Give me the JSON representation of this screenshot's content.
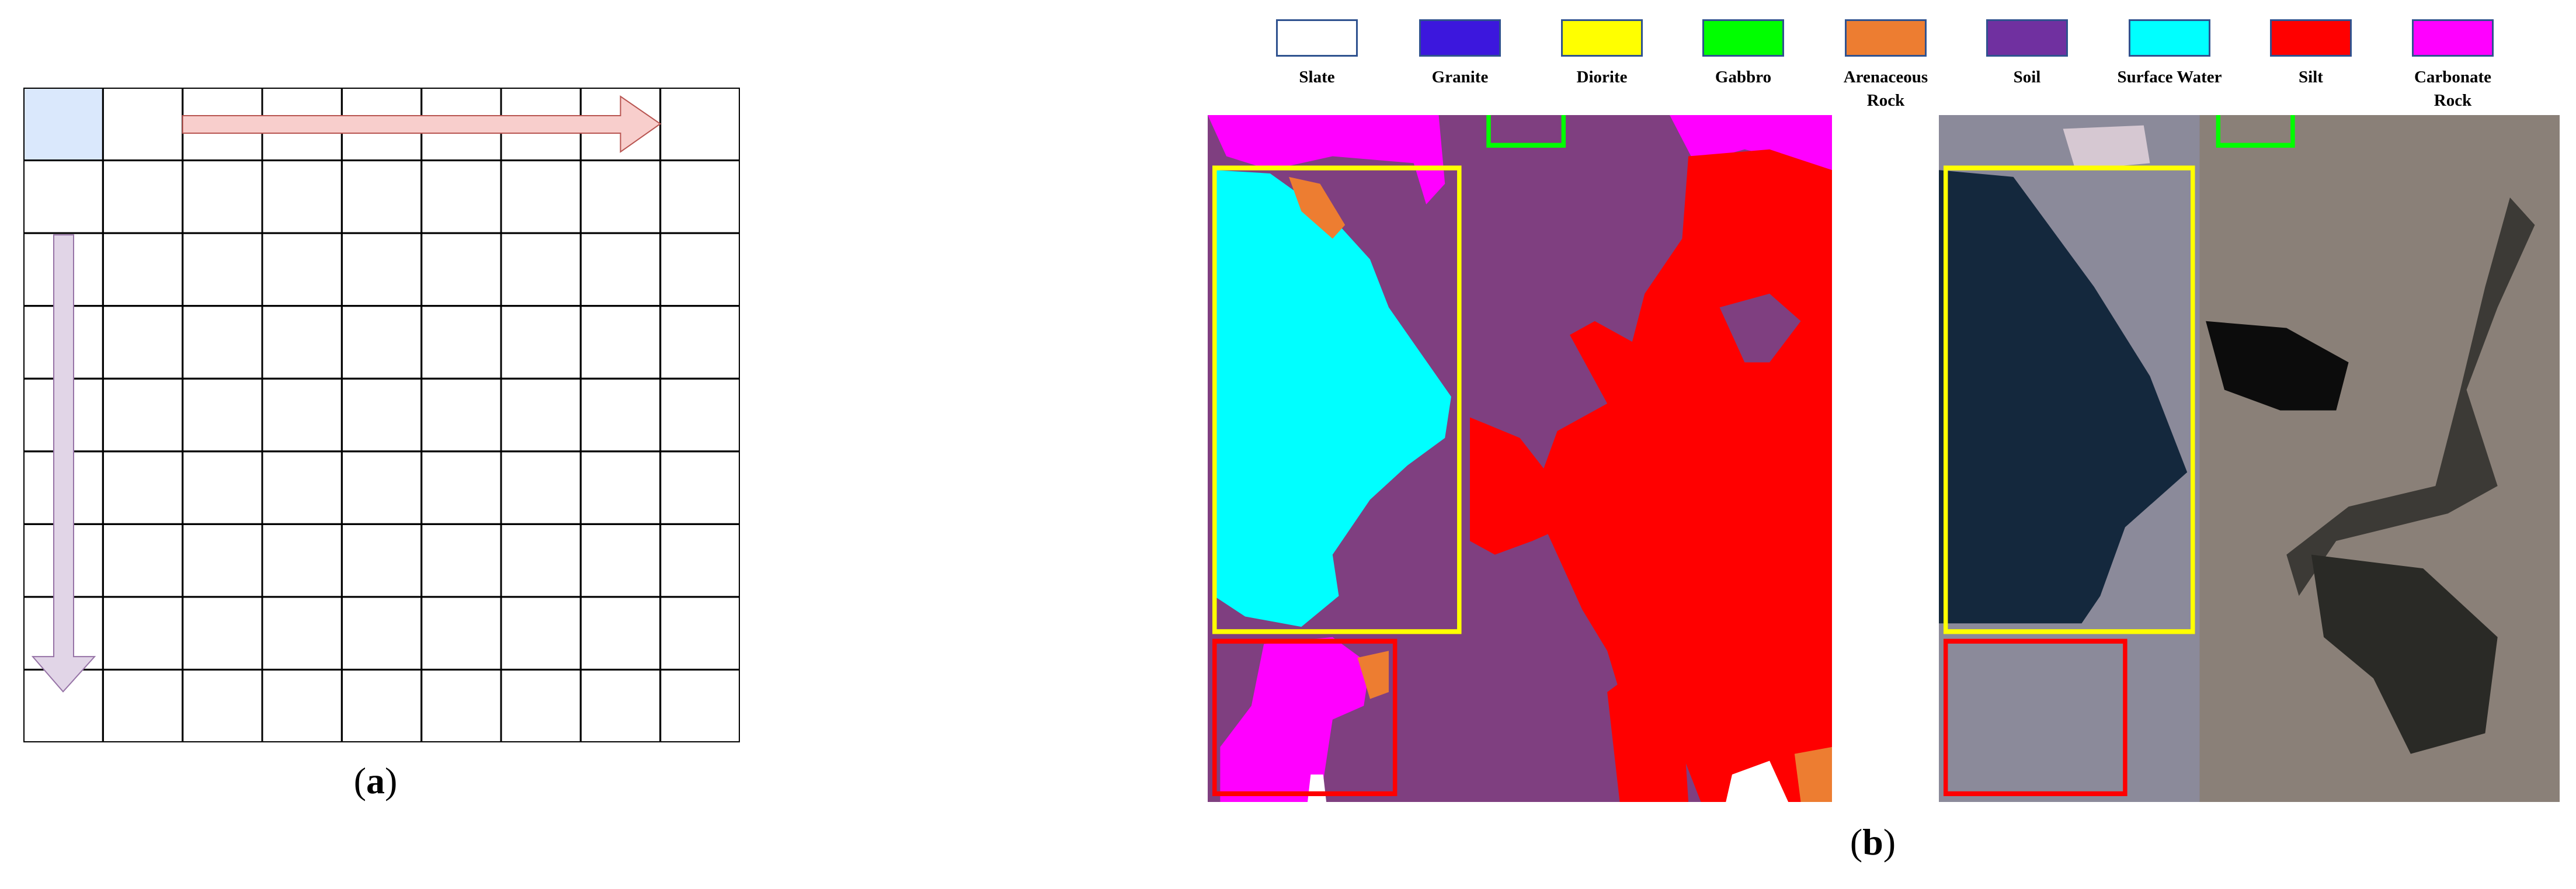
{
  "panel_a": {
    "caption_letter": "a",
    "grid_rows": 9,
    "grid_cols": 9,
    "highlight_color": "#dae8fc",
    "horizontal_arrow_color": "#f8cecc",
    "vertical_arrow_color": "#e1d5e7"
  },
  "panel_b": {
    "caption_letter": "b",
    "legend": [
      {
        "label": "Slate",
        "color": "#ffffff"
      },
      {
        "label": "Granite",
        "color": "#3c17dd"
      },
      {
        "label": "Diorite",
        "color": "#ffff00"
      },
      {
        "label": "Gabbro",
        "color": "#00ff00"
      },
      {
        "label": "Arenaceous Rock",
        "color": "#ed7d31"
      },
      {
        "label": "Soil",
        "color": "#7030a0"
      },
      {
        "label": "Surface Water",
        "color": "#00ffff"
      },
      {
        "label": "Silt",
        "color": "#ff0000"
      },
      {
        "label": "Carbonate Rock",
        "color": "#ff00ff"
      }
    ],
    "highlight_boxes": [
      {
        "color": "#ffff00"
      },
      {
        "color": "#ff0000"
      },
      {
        "color": "#00ff00"
      }
    ]
  }
}
